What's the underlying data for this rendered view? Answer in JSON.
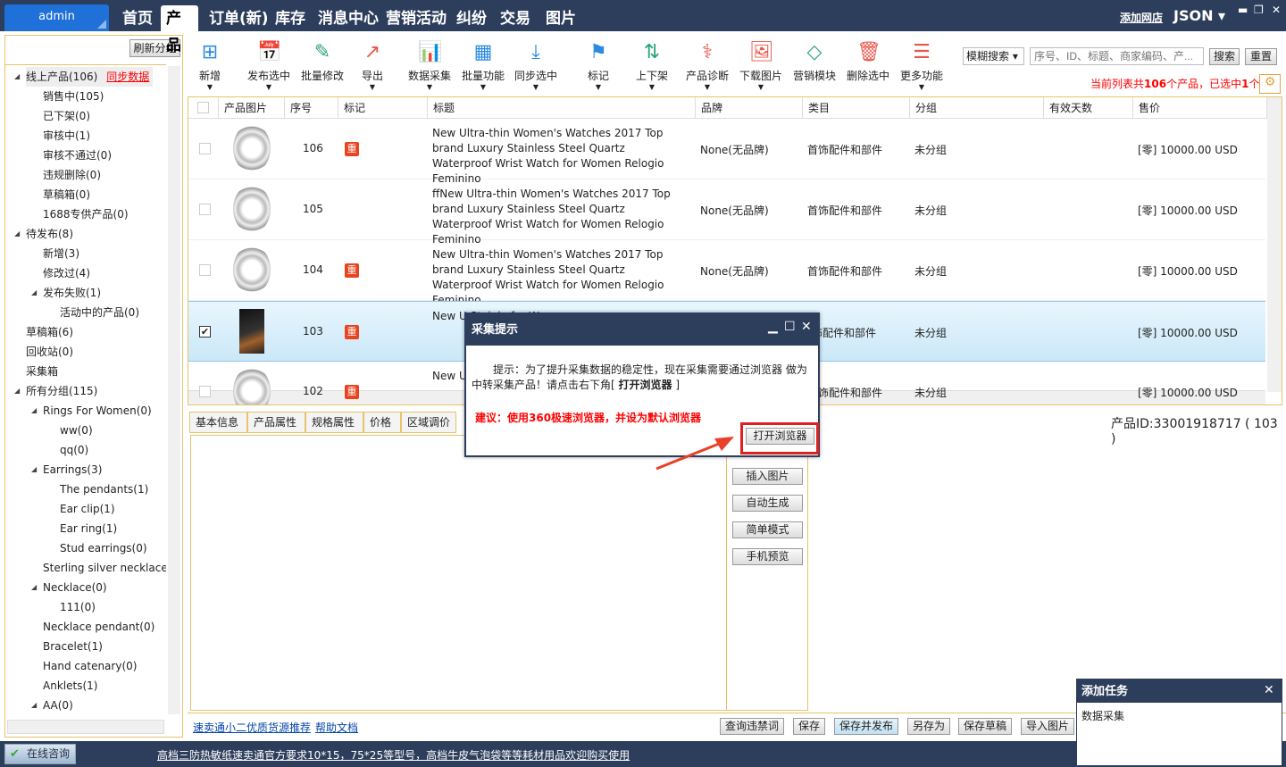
{
  "topbar": {
    "user_box": "admin",
    "tabs": [
      "首页",
      "产品",
      "订单(新)",
      "库存",
      "消息中心",
      "营销活动",
      "纠纷",
      "交易",
      "图片"
    ],
    "active_tab": "产品",
    "add_shop": "添加网店",
    "account": "JSON ▾"
  },
  "left": {
    "refresh": "刷新分组",
    "sync": "同步数据",
    "tree": [
      {
        "label": "线上产品(106)",
        "level": 0,
        "exp": true
      },
      {
        "label": "销售中(105)",
        "level": 1
      },
      {
        "label": "已下架(0)",
        "level": 1
      },
      {
        "label": "审核中(1)",
        "level": 1
      },
      {
        "label": "审核不通过(0)",
        "level": 1
      },
      {
        "label": "违规删除(0)",
        "level": 1
      },
      {
        "label": "草稿箱(0)",
        "level": 1
      },
      {
        "label": "1688专供产品(0)",
        "level": 1
      },
      {
        "label": "待发布(8)",
        "level": 0,
        "exp": true
      },
      {
        "label": "新增(3)",
        "level": 1
      },
      {
        "label": "修改过(4)",
        "level": 1
      },
      {
        "label": "发布失败(1)",
        "level": 1,
        "exp": true
      },
      {
        "label": "活动中的产品(0)",
        "level": 2
      },
      {
        "label": "草稿箱(6)",
        "level": 0
      },
      {
        "label": "回收站(0)",
        "level": 0
      },
      {
        "label": "采集箱",
        "level": 0
      },
      {
        "label": "所有分组(115)",
        "level": 0,
        "exp": true
      },
      {
        "label": "Rings For Women(0)",
        "level": 1,
        "exp": true
      },
      {
        "label": "ww(0)",
        "level": 2
      },
      {
        "label": "qq(0)",
        "level": 2
      },
      {
        "label": "Earrings(3)",
        "level": 1,
        "exp": true
      },
      {
        "label": "The pendants(1)",
        "level": 2
      },
      {
        "label": "Ear clip(1)",
        "level": 2
      },
      {
        "label": "Ear ring(1)",
        "level": 2
      },
      {
        "label": "Stud earrings(0)",
        "level": 2
      },
      {
        "label": "Sterling silver necklace(",
        "level": 1
      },
      {
        "label": "Necklace(0)",
        "level": 1,
        "exp": true
      },
      {
        "label": "111(0)",
        "level": 2
      },
      {
        "label": "Necklace pendant(0)",
        "level": 1
      },
      {
        "label": "Bracelet(1)",
        "level": 1
      },
      {
        "label": "Hand catenary(0)",
        "level": 1
      },
      {
        "label": "Anklets(1)",
        "level": 1
      },
      {
        "label": "AA(0)",
        "level": 1,
        "exp": true
      }
    ]
  },
  "toolbar": [
    {
      "label": "新增",
      "icon": "grid-plus-icon",
      "glyph": "⊞",
      "color": "#2b8be0",
      "dd": true
    },
    {
      "label": "发布选中",
      "icon": "calendar-clock-icon",
      "glyph": "📅",
      "color": "#e8574a",
      "dd": true
    },
    {
      "label": "批量修改",
      "icon": "edit-doc-icon",
      "glyph": "✎",
      "color": "#2aa37c"
    },
    {
      "label": "导出",
      "icon": "export-icon",
      "glyph": "↗",
      "color": "#e8574a",
      "dd": true
    },
    {
      "label": "数据采集",
      "icon": "monitor-chart-icon",
      "glyph": "📊",
      "color": "#e89b2a",
      "dd": true
    },
    {
      "label": "批量功能",
      "icon": "blocks-icon",
      "glyph": "▦",
      "color": "#2b8be0",
      "dd": true
    },
    {
      "label": "同步选中",
      "icon": "download-icon",
      "glyph": "⤓",
      "color": "#2b8be0",
      "dd": true
    },
    {
      "label": "标记",
      "icon": "flag-icon",
      "glyph": "⚑",
      "color": "#2b8be0",
      "dd": true
    },
    {
      "label": "上下架",
      "icon": "sort-up-icon",
      "glyph": "⇅",
      "color": "#2aa37c",
      "dd": true
    },
    {
      "label": "产品诊断",
      "icon": "diagnose-icon",
      "glyph": "⚕",
      "color": "#e8574a",
      "dd": true
    },
    {
      "label": "下载图片",
      "icon": "image-icon",
      "glyph": "🖼",
      "color": "#e8574a",
      "dd": true
    },
    {
      "label": "营销模块",
      "icon": "modules-icon",
      "glyph": "◇",
      "color": "#2aa37c"
    },
    {
      "label": "删除选中",
      "icon": "trash-icon",
      "glyph": "🗑",
      "color": "#e8574a"
    },
    {
      "label": "更多功能",
      "icon": "menu-icon",
      "glyph": "☰",
      "color": "#e8574a",
      "dd": true
    }
  ],
  "search": {
    "mode": "模糊搜索",
    "placeholder": "序号、ID、标题、商家编码、产...",
    "search": "搜索",
    "reset": "重置",
    "count_prefix": "当前列表共",
    "count": "106",
    "count_mid": "个产品，已选中",
    "selected": "1",
    "count_suffix": "个"
  },
  "grid": {
    "columns": [
      "产品图片",
      "序号",
      "标记",
      "标题",
      "品牌",
      "类目",
      "分组",
      "有效天数",
      "售价"
    ],
    "rows": [
      {
        "no": "106",
        "tag": "重",
        "title": "New Ultra-thin Women's Watches 2017 Top brand Luxury Stainless Steel Quartz Waterproof Wrist Watch for Women Relogio Feminino",
        "brand": "None(无品牌)",
        "cat": "首饰配件和部件",
        "group": "未分组",
        "price": "[零] 10000.00 USD",
        "checked": false
      },
      {
        "no": "105",
        "tag": "",
        "title": "ffNew Ultra-thin Women's Watches 2017 Top brand Luxury Stainless Steel Quartz Waterproof Wrist Watch for Women Relogio Feminino",
        "brand": "None(无品牌)",
        "cat": "首饰配件和部件",
        "group": "未分组",
        "price": "[零] 10000.00 USD",
        "checked": false
      },
      {
        "no": "104",
        "tag": "重",
        "title": "New Ultra-thin Women's Watches 2017 Top brand Luxury Stainless Steel Quartz Waterproof Wrist Watch for Women Relogio Feminino",
        "brand": "None(无品牌)",
        "cat": "首饰配件和部件",
        "group": "未分组",
        "price": "[零] 10000.00 USD",
        "checked": false
      },
      {
        "no": "103",
        "tag": "重",
        "title": "New U Stainle for Wo",
        "brand": "",
        "cat": "饰配件和部件",
        "group": "未分组",
        "price": "[零] 10000.00 USD",
        "checked": true
      },
      {
        "no": "102",
        "tag": "重",
        "title": "New U",
        "brand": "",
        "cat": "首饰配件和部件",
        "group": "未分组",
        "price": "[零] 10000.00 USD",
        "checked": false
      }
    ]
  },
  "detail": {
    "tabs": [
      "基本信息",
      "产品属性",
      "规格属性",
      "价格",
      "区域调价"
    ],
    "product_id": "产品ID:33001918717 ( 103 )",
    "side_buttons": [
      "插入图片",
      "自动生成",
      "简单模式",
      "手机预览"
    ]
  },
  "bottom": {
    "links": [
      "速卖通小二优质货源推荐",
      "帮助文档"
    ],
    "buttons": [
      "查询违禁词",
      "保存",
      "保存并发布",
      "另存为",
      "保存草稿",
      "导入图片"
    ]
  },
  "footer": {
    "consult": "在线咨询",
    "ad": "高档三防热敏纸速卖通官方要求10*15，75*25等型号，高档牛皮气泡袋等等耗材用品欢迎购买使用"
  },
  "dialog": {
    "title": "采集提示",
    "message_prefix": "提示：为了提升采集数据的稳定性，现在采集需要通过浏览器 做为中转采集产品！请点击右下角[ ",
    "message_bold": "打开浏览器",
    "message_suffix": " ]",
    "warning": "建议：使用360极速浏览器，并设为默认浏览器",
    "open_button": "打开浏览器"
  },
  "task": {
    "title": "添加任务",
    "item": "数据采集"
  }
}
